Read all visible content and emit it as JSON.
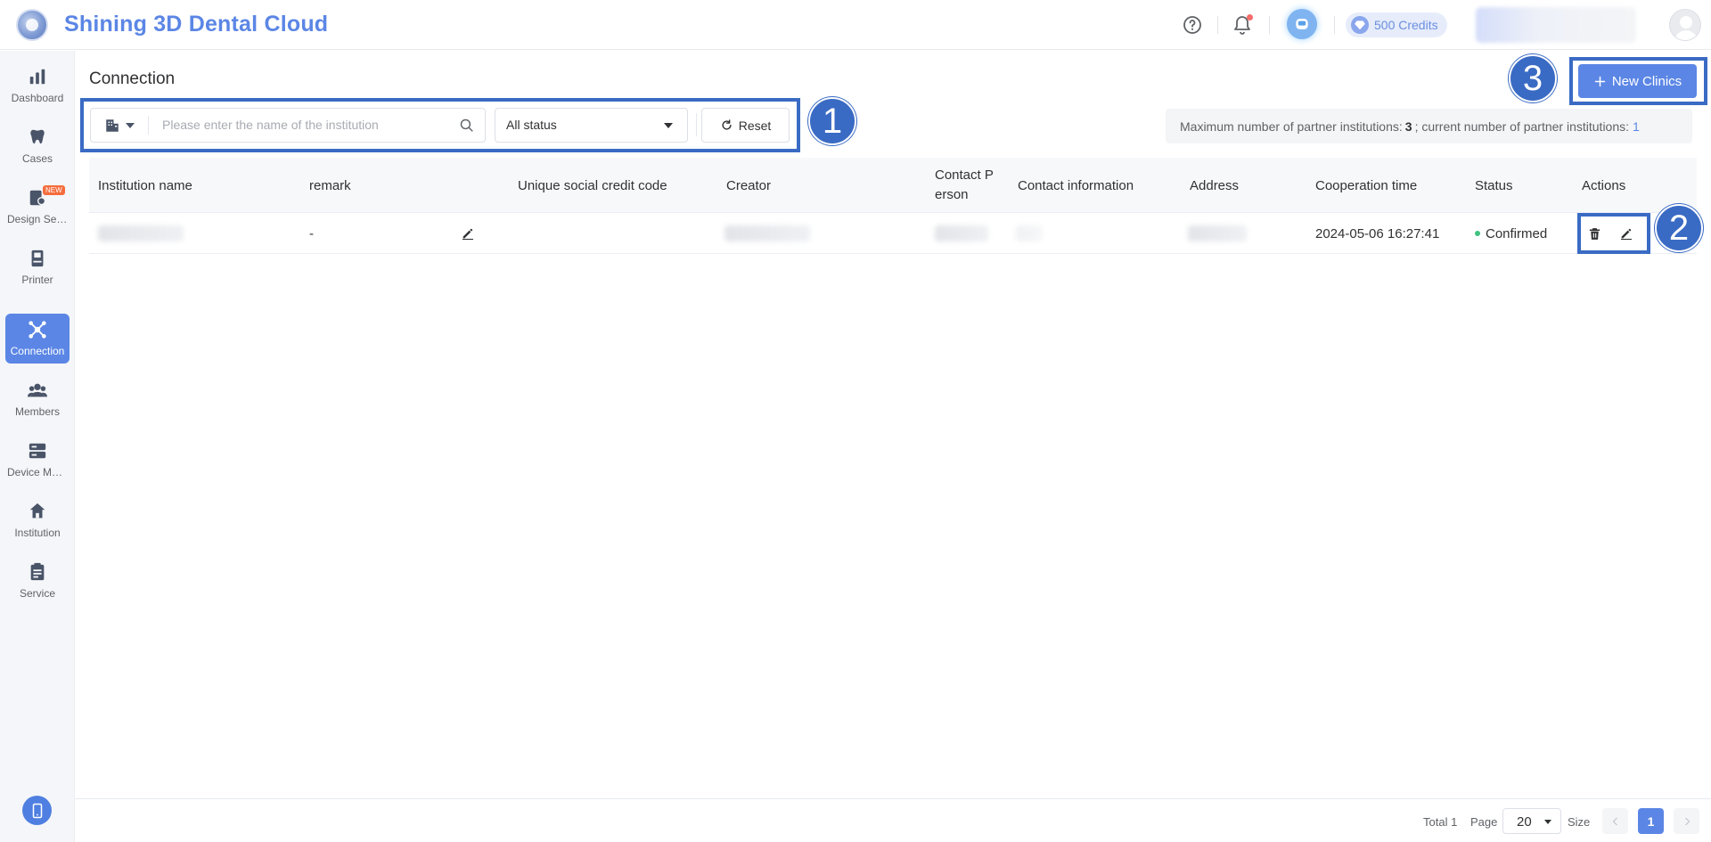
{
  "header": {
    "app_title": "Shining 3D Dental Cloud",
    "credits_label": "500 Credits",
    "icons": [
      "help-icon",
      "bell-icon",
      "tooth-icon",
      "gem-icon"
    ]
  },
  "sidebar": {
    "items": [
      {
        "label": "Dashboard",
        "icon": "bar-chart-icon"
      },
      {
        "label": "Cases",
        "icon": "tooth-icon"
      },
      {
        "label": "Design Service",
        "icon": "design-icon",
        "badge": "NEW"
      },
      {
        "label": "Printer",
        "icon": "printer-icon"
      },
      {
        "label": "Connection",
        "icon": "connection-icon",
        "active": true
      },
      {
        "label": "Members",
        "icon": "members-icon"
      },
      {
        "label": "Device Management",
        "icon": "device-icon"
      },
      {
        "label": "Institution",
        "icon": "institution-icon"
      },
      {
        "label": "Service",
        "icon": "clipboard-icon"
      }
    ]
  },
  "main": {
    "page_title": "Connection",
    "search_placeholder": "Please enter the name of the institution",
    "status_select_value": "All status",
    "reset_label": "Reset",
    "new_button_label": "New Clinics",
    "info": {
      "prefix": "Maximum number of partner institutions:",
      "max": "3",
      "middle": "; current number of partner institutions:",
      "current": "1"
    },
    "markers": [
      "1",
      "2",
      "3"
    ]
  },
  "table": {
    "columns": [
      "Institution name",
      "remark",
      "Unique social credit code",
      "Creator",
      "Contact P erson",
      "Contact information",
      "Address",
      "Cooperation time",
      "Status",
      "Actions"
    ],
    "rows": [
      {
        "remark": "-",
        "cooperation_time": "2024-05-06 16:27:41",
        "status": "Confirmed"
      }
    ]
  },
  "pagination": {
    "total_label": "Total 1",
    "page_label": "Page",
    "size_value": "20",
    "size_label": "Size",
    "current_page": "1"
  },
  "colors": {
    "accent": "#5b86e5",
    "annotation": "#3a6bc4",
    "status_confirmed": "#3ec27f"
  }
}
